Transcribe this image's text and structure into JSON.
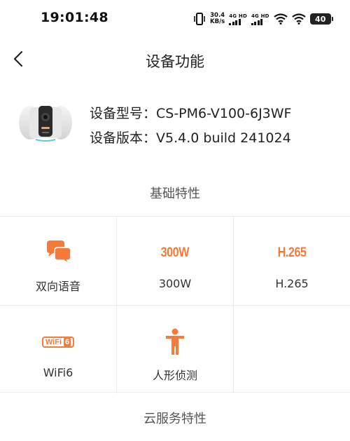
{
  "status_bar": {
    "time": "19:01:48",
    "net_speed_value": "30.4",
    "net_speed_unit": "KB/s",
    "sim1_label": "4G HD",
    "sim2_label": "4G HD",
    "battery": "40"
  },
  "header": {
    "title": "设备功能"
  },
  "device": {
    "model_line": "设备型号：CS-PM6-V100-6J3WF",
    "version_line": "设备版本：V5.4.0 build 241024"
  },
  "sections": {
    "basic_title": "基础特性",
    "cloud_title": "云服务特性"
  },
  "features": [
    {
      "label": "双向语音",
      "icon": "chat-bubbles-icon"
    },
    {
      "label": "300W",
      "icon": "300w-icon",
      "icon_text": "300W"
    },
    {
      "label": "H.265",
      "icon": "h265-icon",
      "icon_text": "H.265"
    },
    {
      "label": "WiFi6",
      "icon": "wifi6-icon",
      "icon_text": "WiFi",
      "icon_text2": "6"
    },
    {
      "label": "人形侦测",
      "icon": "human-figure-icon"
    }
  ],
  "colors": {
    "accent": "#f47b3a",
    "text": "#222222",
    "divider": "#ececec"
  }
}
